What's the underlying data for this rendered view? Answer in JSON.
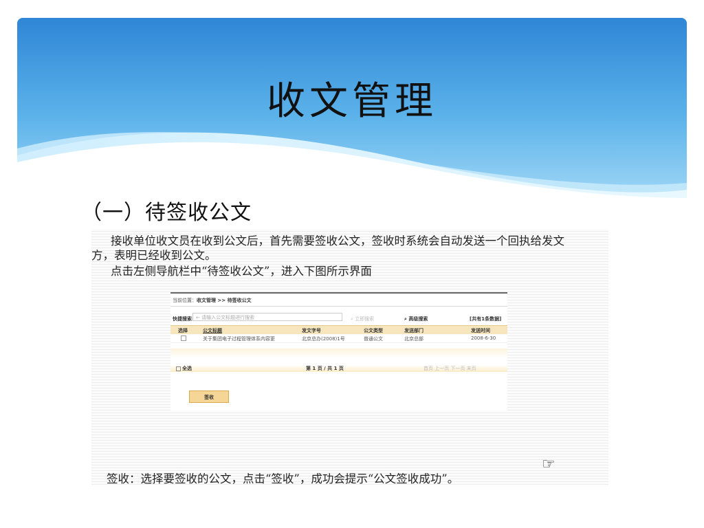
{
  "slide": {
    "title": "收文管理",
    "section_heading": "（一）待签收公文"
  },
  "document": {
    "paragraph1_line1": "接收单位收文员在收到公文后，首先需要签收公文，签收时系统会自动发送一个回执给发文",
    "paragraph1_line2": "方，表明已经收到公文。",
    "paragraph2": "点击左侧导航栏中“待签收公文”，进入下图所示界面",
    "paragraph3": "签收：选择要签收的公文，点击“签收”，成功会提示“公文签收成功”。",
    "hand_icon": "☞"
  },
  "system_ui": {
    "breadcrumb_prefix": "当前位置：",
    "breadcrumb_path": "收文管理 >> 待签收公文",
    "quick_search_label": "快捷搜索:",
    "search_placeholder": "← 请输入公文标题进行搜索",
    "search_button": "立即搜索",
    "advanced_search_button": "高级搜索",
    "record_count": "[共有1条数据]",
    "columns": [
      "选择",
      "公文标题",
      "发文字号",
      "公文类型",
      "发送部门",
      "发送时间"
    ],
    "rows": [
      {
        "title": "关于集团电子过程管理体系内容更",
        "doc_number": "北京总办(2008)1号",
        "doc_type": "普通公文",
        "department": "北京总部",
        "send_time": "2008-6-30"
      }
    ],
    "select_all": "全选",
    "pagination": "第 1 页 / 共 1 页",
    "pager_links": "首页 上一页 下一页 末页",
    "sign_button": "签收"
  },
  "colors": {
    "banner_sky": "#4fa3e0",
    "table_header": "#f7e6bd",
    "sign_button": "#f6d696"
  }
}
